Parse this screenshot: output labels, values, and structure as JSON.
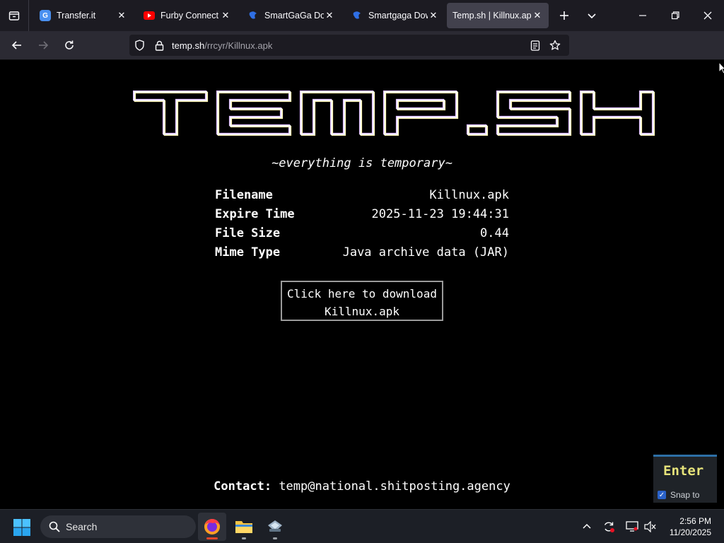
{
  "browser": {
    "tabs": [
      {
        "title": "Transfer.it",
        "icon": "transfer-favicon",
        "active": false
      },
      {
        "title": "Furby Connect fi",
        "icon": "youtube-favicon",
        "active": false
      },
      {
        "title": "SmartGaGa Dow",
        "icon": "smartgaga-favicon",
        "active": false
      },
      {
        "title": "Smartgaga Dow",
        "icon": "smartgaga-favicon",
        "active": false
      },
      {
        "title": "Temp.sh | Killnux.apk",
        "icon": "none",
        "active": true
      }
    ],
    "url_host": "temp.sh",
    "url_path": "/rrcyr/Killnux.apk"
  },
  "page": {
    "logo_text": "TEMP.SH",
    "tagline": "~everything is temporary~",
    "info": [
      {
        "key": "Filename",
        "value": "Killnux.apk"
      },
      {
        "key": "Expire Time",
        "value": "2025-11-23 19:44:31"
      },
      {
        "key": "File Size",
        "value": "0.44"
      },
      {
        "key": "Mime Type",
        "value": "Java archive data (JAR)"
      }
    ],
    "download_line1": "Click here to download",
    "download_line2": "Killnux.apk",
    "contact_label": "Contact:",
    "contact_email": "temp@national.shitposting.agency"
  },
  "overlay": {
    "enter_label": "Enter",
    "snap_label": "Snap to"
  },
  "taskbar": {
    "search_label": "Search",
    "time": "2:56 PM",
    "date": "11/20/2025"
  },
  "colors": {
    "tab_bar": "#1c1b22",
    "nav_bar": "#2b2a33",
    "page_bg": "#000000",
    "enter_text": "#e6e37a",
    "taskbar_bg": "#1c1f26"
  }
}
